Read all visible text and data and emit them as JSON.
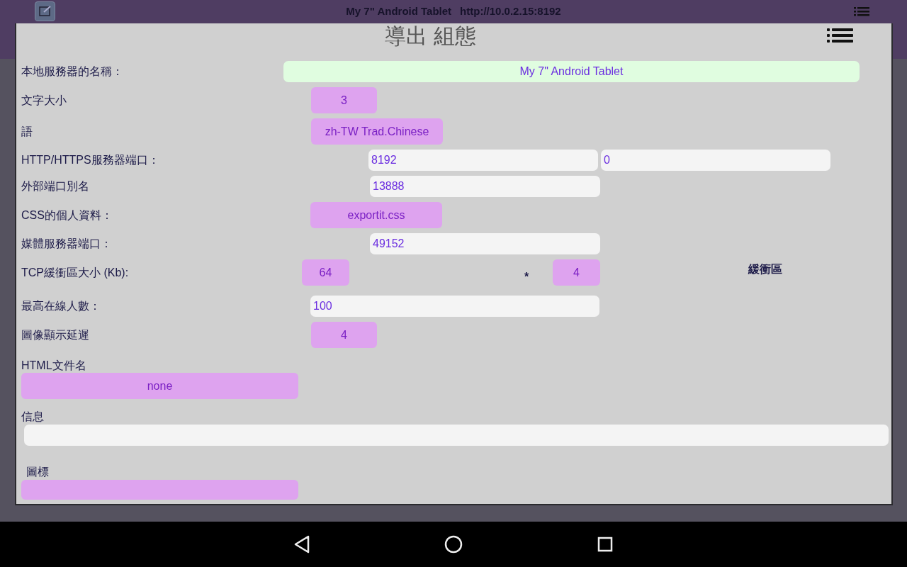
{
  "top_bar": {
    "title": "My 7\" Android Tablet",
    "url": "http://10.0.2.15:8192"
  },
  "dialog": {
    "title": "導出 組態",
    "rows": [
      {
        "kind": "inline",
        "label": "本地服務器的名稱：",
        "controls": [
          {
            "kind": "name",
            "value": "My 7\" Android Tablet"
          }
        ]
      },
      {
        "kind": "inline",
        "label": "文字大小",
        "controls": [
          {
            "kind": "dropdown",
            "value": "3"
          }
        ]
      },
      {
        "kind": "inline",
        "label": "語",
        "controls": [
          {
            "kind": "dropdown",
            "value": "zh-TW Trad.Chinese"
          }
        ]
      },
      {
        "kind": "inline",
        "label": "HTTP/HTTPS服務器端口：",
        "controls": [
          {
            "kind": "input",
            "value": "8192"
          },
          {
            "kind": "input",
            "value": "0"
          }
        ]
      },
      {
        "kind": "inline",
        "label": "外部端口別名",
        "controls": [
          {
            "kind": "input",
            "value": "13888"
          }
        ]
      },
      {
        "kind": "inline",
        "label": "CSS的個人資料：",
        "controls": [
          {
            "kind": "dropdown",
            "value": "exportit.css"
          }
        ]
      },
      {
        "kind": "inline",
        "label": "媒體服務器端口：",
        "controls": [
          {
            "kind": "input",
            "value": "49152"
          }
        ]
      },
      {
        "kind": "inline",
        "label": "TCP緩衝區大小 (Kb):",
        "controls": [
          {
            "kind": "dropdown",
            "value": "64"
          },
          {
            "kind": "text",
            "value": "*"
          },
          {
            "kind": "dropdown",
            "value": "4"
          },
          {
            "kind": "text",
            "value": "緩衝區"
          }
        ]
      },
      {
        "kind": "inline",
        "label": "最高在線人數：",
        "controls": [
          {
            "kind": "input",
            "value": "100"
          }
        ]
      },
      {
        "kind": "inline",
        "label": "圖像顯示延遲",
        "controls": [
          {
            "kind": "dropdown",
            "value": "4"
          }
        ]
      },
      {
        "kind": "stacked",
        "label": "HTML文件名",
        "controls": [
          {
            "kind": "dropdown",
            "value": "none"
          }
        ]
      },
      {
        "kind": "stacked",
        "label": "信息",
        "controls": [
          {
            "kind": "input"
          }
        ]
      },
      {
        "kind": "stacked",
        "label": "圖標",
        "controls": [
          {
            "kind": "dropdown"
          }
        ]
      }
    ]
  }
}
